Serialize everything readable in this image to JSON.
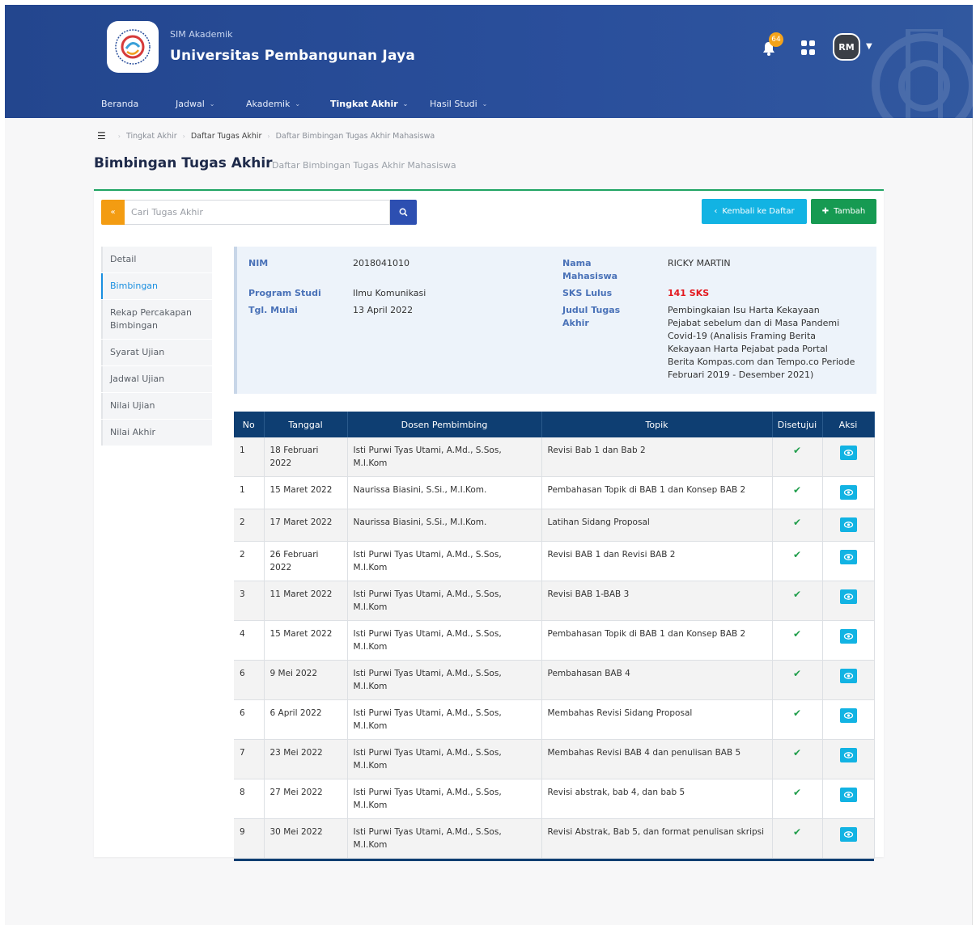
{
  "header": {
    "app_subtitle": "SIM Akademik",
    "university_name": "Universitas Pembangunan Jaya",
    "notification_count": "64",
    "user_initials": "RM"
  },
  "nav": [
    {
      "label": "Beranda",
      "has_dropdown": false
    },
    {
      "label": "Jadwal",
      "has_dropdown": true
    },
    {
      "label": "Akademik",
      "has_dropdown": true
    },
    {
      "label": "Tingkat Akhir",
      "has_dropdown": true,
      "active": true
    },
    {
      "label": "Hasil Studi",
      "has_dropdown": true
    }
  ],
  "breadcrumb": [
    "Tingkat Akhir",
    "Daftar Tugas Akhir",
    "Daftar Bimbingan Tugas Akhir Mahasiswa"
  ],
  "page": {
    "title": "Bimbingan Tugas Akhir",
    "subtitle": "Daftar Bimbingan Tugas Akhir Mahasiswa"
  },
  "toolbar": {
    "back_icon": "«",
    "search_placeholder": "Cari Tugas Akhir",
    "kembali_label": "Kembali ke Daftar",
    "tambah_label": "Tambah"
  },
  "sidemenu": [
    {
      "label": "Detail"
    },
    {
      "label": "Bimbingan",
      "active": true
    },
    {
      "label": "Rekap Percakapan Bimbingan"
    },
    {
      "label": "Syarat Ujian"
    },
    {
      "label": "Jadwal Ujian"
    },
    {
      "label": "Nilai Ujian"
    },
    {
      "label": "Nilai Akhir"
    }
  ],
  "student": {
    "nim_label": "NIM",
    "nim": "2018041010",
    "prodi_label": "Program Studi",
    "prodi": "Ilmu Komunikasi",
    "mulai_label": "Tgl. Mulai",
    "mulai": "13 April 2022",
    "nama_label": "Nama Mahasiswa",
    "nama": "RICKY MARTIN",
    "sks_label": "SKS Lulus",
    "sks": "141 SKS",
    "judul_label": "Judul Tugas Akhir",
    "judul": "Pembingkaian Isu Harta Kekayaan Pejabat sebelum dan di Masa Pandemi Covid-19 (Analisis Framing Berita Kekayaan Harta Pejabat pada Portal Berita Kompas.com dan Tempo.co Periode Februari 2019 - Desember 2021)"
  },
  "table": {
    "headers": [
      "No",
      "Tanggal",
      "Dosen Pembimbing",
      "Topik",
      "Disetujui",
      "Aksi"
    ],
    "rows": [
      {
        "no": "1",
        "tanggal": "18 Februari 2022",
        "dosen": "Isti Purwi Tyas Utami, A.Md., S.Sos, M.I.Kom",
        "topik": "Revisi Bab 1 dan Bab 2",
        "disetujui": "✔"
      },
      {
        "no": "1",
        "tanggal": "15 Maret 2022",
        "dosen": "Naurissa Biasini, S.Si., M.I.Kom.",
        "topik": "Pembahasan Topik di BAB 1 dan Konsep BAB 2",
        "disetujui": "✔"
      },
      {
        "no": "2",
        "tanggal": "17 Maret 2022",
        "dosen": "Naurissa Biasini, S.Si., M.I.Kom.",
        "topik": "Latihan Sidang Proposal",
        "disetujui": "✔"
      },
      {
        "no": "2",
        "tanggal": "26 Februari 2022",
        "dosen": "Isti Purwi Tyas Utami, A.Md., S.Sos, M.I.Kom",
        "topik": "Revisi BAB 1 dan Revisi BAB 2",
        "disetujui": "✔"
      },
      {
        "no": "3",
        "tanggal": "11 Maret 2022",
        "dosen": "Isti Purwi Tyas Utami, A.Md., S.Sos, M.I.Kom",
        "topik": "Revisi BAB 1-BAB 3",
        "disetujui": "✔"
      },
      {
        "no": "4",
        "tanggal": "15 Maret 2022",
        "dosen": "Isti Purwi Tyas Utami, A.Md., S.Sos, M.I.Kom",
        "topik": "Pembahasan Topik di BAB 1 dan Konsep BAB 2",
        "disetujui": "✔"
      },
      {
        "no": "6",
        "tanggal": "9 Mei 2022",
        "dosen": "Isti Purwi Tyas Utami, A.Md., S.Sos, M.I.Kom",
        "topik": "Pembahasan BAB 4",
        "disetujui": "✔"
      },
      {
        "no": "6",
        "tanggal": "6 April 2022",
        "dosen": "Isti Purwi Tyas Utami, A.Md., S.Sos, M.I.Kom",
        "topik": "Membahas Revisi Sidang Proposal",
        "disetujui": "✔"
      },
      {
        "no": "7",
        "tanggal": "23 Mei 2022",
        "dosen": "Isti Purwi Tyas Utami, A.Md., S.Sos, M.I.Kom",
        "topik": "Membahas Revisi BAB 4 dan penulisan BAB 5",
        "disetujui": "✔"
      },
      {
        "no": "8",
        "tanggal": "27 Mei 2022",
        "dosen": "Isti Purwi Tyas Utami, A.Md., S.Sos, M.I.Kom",
        "topik": "Revisi abstrak, bab 4, dan bab 5",
        "disetujui": "✔"
      },
      {
        "no": "9",
        "tanggal": "30 Mei 2022",
        "dosen": "Isti Purwi Tyas Utami, A.Md., S.Sos, M.I.Kom",
        "topik": "Revisi Abstrak, Bab 5, dan format penulisan skripsi",
        "disetujui": "✔"
      }
    ]
  }
}
